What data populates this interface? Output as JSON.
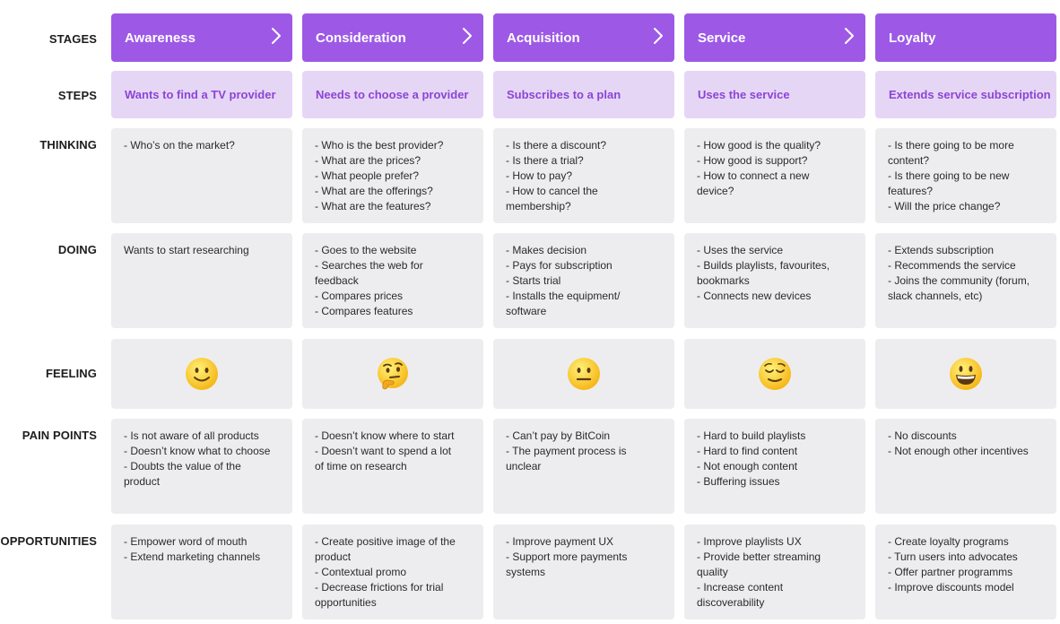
{
  "row_labels": {
    "stages": "STAGES",
    "steps": "STEPS",
    "thinking": "THINKING",
    "doing": "DOING",
    "feeling": "FEELING",
    "pain_points": "PAIN POINTS",
    "opportunities": "OPPORTUNITIES"
  },
  "columns": [
    {
      "stage": "Awareness",
      "has_chevron": true,
      "step": "Wants to find a TV provider",
      "thinking": "- Who’s on the market?",
      "doing": "Wants to start researching",
      "feeling_icon": "slightly-smiling-face-icon",
      "pain_points": "- Is not aware of all products\n- Doesn’t know what to choose\n- Doubts the value of the\nproduct",
      "opportunities": "- Empower word of mouth\n- Extend marketing channels"
    },
    {
      "stage": "Consideration",
      "has_chevron": true,
      "step": "Needs to choose a provider",
      "thinking": "- Who is the best provider?\n- What are the prices?\n- What people prefer?\n- What are the offerings?\n- What are the features?",
      "doing": "- Goes to the website\n- Searches the web for\nfeedback\n- Compares prices\n- Compares features",
      "feeling_icon": "thinking-face-icon",
      "pain_points": "- Doesn’t know where to start\n- Doesn’t want to spend a lot\nof time on research",
      "opportunities": "- Create positive image of the\nproduct\n- Contextual promo\n- Decrease frictions for trial\nopportunities"
    },
    {
      "stage": "Acquisition",
      "has_chevron": true,
      "step": "Subscribes to a plan",
      "thinking": "- Is there a discount?\n- Is there a trial?\n- How to pay?\n- How to cancel the\nmembership?",
      "doing": "- Makes decision\n- Pays for subscription\n- Starts trial\n- Installs the equipment/\nsoftware",
      "feeling_icon": "neutral-face-icon",
      "pain_points": "- Can’t pay by BitCoin\n- The payment process is\nunclear",
      "opportunities": "- Improve payment UX\n- Support more payments\nsystems"
    },
    {
      "stage": "Service",
      "has_chevron": true,
      "step": "Uses the service",
      "thinking": "- How good is the quality?\n- How good is support?\n- How to connect a new\ndevice?",
      "doing": "- Uses the service\n- Builds playlists, favourites,\nbookmarks\n- Connects new devices",
      "feeling_icon": "relieved-face-icon",
      "pain_points": "- Hard to build playlists\n- Hard to find content\n- Not enough content\n- Buffering issues",
      "opportunities": "- Improve playlists UX\n- Provide better streaming\nquality\n- Increase content\ndiscoverability"
    },
    {
      "stage": "Loyalty",
      "has_chevron": false,
      "step": "Extends  service subscription",
      "thinking": "- Is there going to be more\ncontent?\n- Is there going to be new\nfeatures?\n- Will the price change?",
      "doing": "- Extends subscription\n- Recommends the service\n- Joins the community (forum,\nslack channels, etc)",
      "feeling_icon": "grinning-face-icon",
      "pain_points": "- No discounts\n- Not enough other incentives",
      "opportunities": "- Create loyalty programs\n- Turn users into advocates\n- Offer partner programms\n- Improve discounts model"
    }
  ],
  "colors": {
    "stage_bg": "#9d59e6",
    "step_bg": "#e6d6f6",
    "step_text": "#8b45d4",
    "cell_bg": "#ededf0"
  }
}
